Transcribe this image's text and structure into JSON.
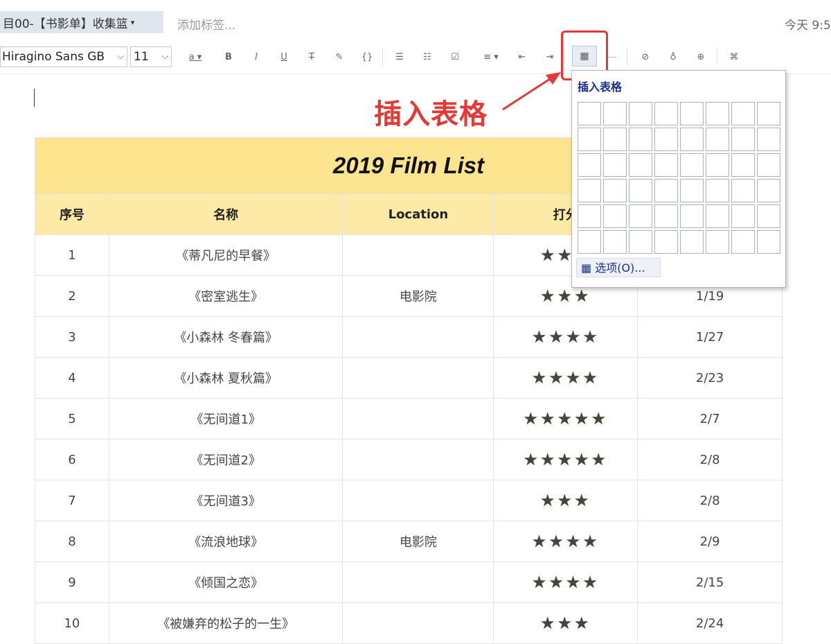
{
  "header": {
    "notebook": "目00-【书影单】收集篮",
    "tag_placeholder": "添加标签...",
    "time": "今天 9:5"
  },
  "toolbar": {
    "font_family": "Hiragino Sans GB",
    "font_size": "11",
    "icons": [
      "font-color-icon",
      "bold-icon",
      "italic-icon",
      "underline-icon",
      "strikethrough-icon",
      "highlight-icon",
      "code-icon",
      "bullet-list-icon",
      "numbered-list-icon",
      "checkbox-icon",
      "align-icon",
      "outdent-icon",
      "indent-icon",
      "insert-table-icon",
      "horizontal-rule-icon",
      "attachment-icon",
      "encrypt-icon",
      "link-icon",
      "more-icon"
    ]
  },
  "annotation": {
    "text": "插入表格",
    "color": "#e53935"
  },
  "table_popup": {
    "title": "插入表格",
    "grid_rows": 6,
    "grid_cols": 8,
    "options_label": "选项(O)..."
  },
  "film_table": {
    "title": "2019 Film List",
    "headers": [
      "序号",
      "名称",
      "Location",
      "打分",
      ""
    ],
    "rows": [
      {
        "no": "1",
        "name": "《蒂凡尼的早餐》",
        "location": "",
        "stars": "★★★",
        "date": ""
      },
      {
        "no": "2",
        "name": "《密室逃生》",
        "location": "电影院",
        "stars": "★★★",
        "date": "1/19"
      },
      {
        "no": "3",
        "name": "《小森林 冬春篇》",
        "location": "",
        "stars": "★★★★",
        "date": "1/27"
      },
      {
        "no": "4",
        "name": "《小森林 夏秋篇》",
        "location": "",
        "stars": "★★★★",
        "date": "2/23"
      },
      {
        "no": "5",
        "name": "《无间道1》",
        "location": "",
        "stars": "★★★★★",
        "date": "2/7"
      },
      {
        "no": "6",
        "name": "《无间道2》",
        "location": "",
        "stars": "★★★★★",
        "date": "2/8"
      },
      {
        "no": "7",
        "name": "《无间道3》",
        "location": "",
        "stars": "★★★",
        "date": "2/8"
      },
      {
        "no": "8",
        "name": "《流浪地球》",
        "location": "电影院",
        "stars": "★★★★",
        "date": "2/9"
      },
      {
        "no": "9",
        "name": "《倾国之恋》",
        "location": "",
        "stars": "★★★★",
        "date": "2/15"
      },
      {
        "no": "10",
        "name": "《被嫌弃的松子的一生》",
        "location": "",
        "stars": "★★★",
        "date": "2/24"
      }
    ]
  },
  "colors": {
    "title_bg": "#fde48e",
    "header_bg": "#fdeaa6",
    "star": "#f4b400",
    "highlight": "#e53935"
  }
}
